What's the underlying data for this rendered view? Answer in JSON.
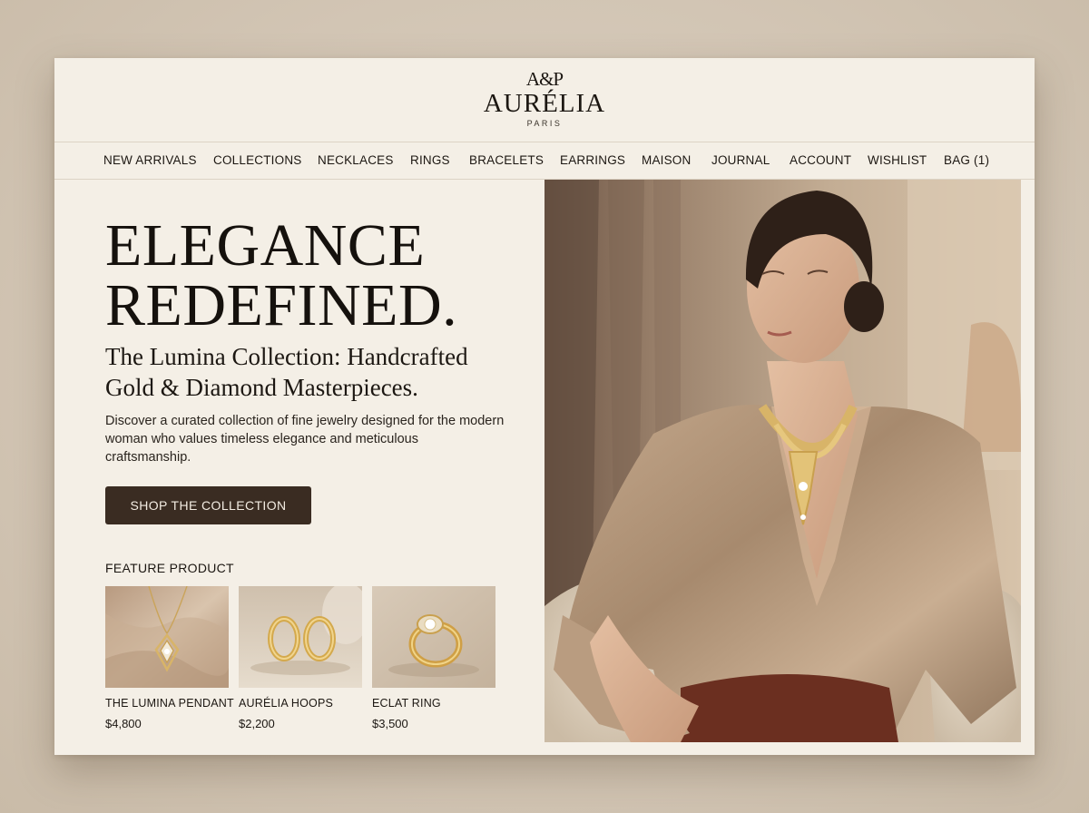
{
  "brand": {
    "monogram": "A&P",
    "name": "AURÉLIA",
    "sub": "PARIS"
  },
  "nav": [
    {
      "label": "NEW ARRIVALS"
    },
    {
      "label": "COLLECTIONS"
    },
    {
      "label": "NECKLACES"
    },
    {
      "label": "RINGS"
    },
    {
      "label": "BRACELETS"
    },
    {
      "label": "EARRINGS"
    },
    {
      "label": "MAISON"
    },
    {
      "label": "JOURNAL"
    },
    {
      "label": "ACCOUNT"
    },
    {
      "label": "WISHLIST"
    },
    {
      "label": "BAG (1)"
    }
  ],
  "hero": {
    "title_line1": "ELEGANCE",
    "title_line2": "REDEFINED.",
    "subtitle_line1": "The Lumina Collection: Handcrafted",
    "subtitle_line2": "Gold & Diamond Masterpieces.",
    "description": "Discover a curated collection of fine jewelry designed for the modern woman who values timeless elegance and meticulous craftsmanship.",
    "cta_label": "SHOP THE COLLECTION"
  },
  "feature": {
    "heading": "FEATURE PRODUCT",
    "products": [
      {
        "name": "THE LUMINA PENDANT",
        "price": "$4,800",
        "icon": "pendant-necklace-icon"
      },
      {
        "name": "AURÉLIA HOOPS",
        "price": "$2,200",
        "icon": "hoop-earrings-icon"
      },
      {
        "name": "ECLAT RING",
        "price": "$3,500",
        "icon": "diamond-ring-icon"
      }
    ]
  },
  "colors": {
    "page_bg": "#f4efe6",
    "cta_bg": "#3a2c22",
    "gold": "#c9a04e",
    "satin": "#a88c70"
  }
}
